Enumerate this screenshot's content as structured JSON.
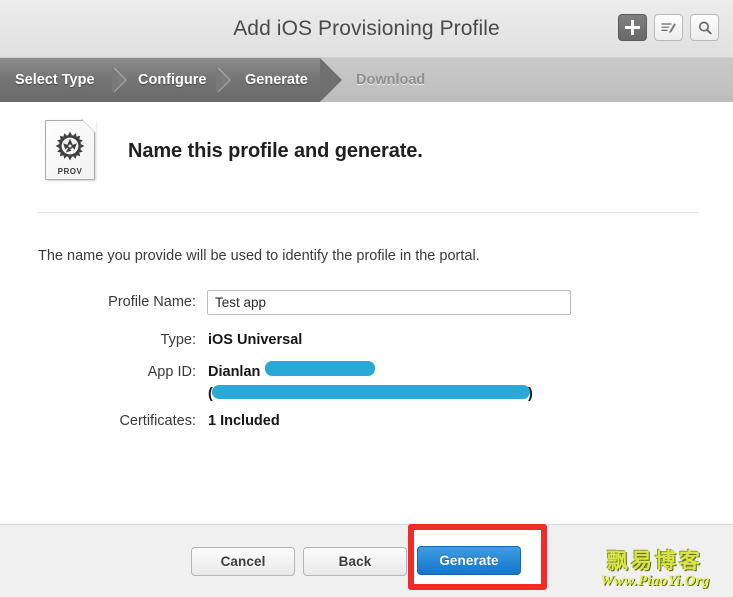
{
  "window": {
    "title": "Add iOS Provisioning Profile"
  },
  "toolbar": {
    "add_icon": "plus-icon",
    "edit_icon": "edit-pencil-icon",
    "search_icon": "search-icon"
  },
  "steps": [
    {
      "label": "Select Type",
      "state": "done"
    },
    {
      "label": "Configure",
      "state": "done"
    },
    {
      "label": "Generate",
      "state": "current"
    },
    {
      "label": "Download",
      "state": "upcoming"
    }
  ],
  "header": {
    "icon_label": "PROV",
    "icon_name": "provisioning-profile-document-icon",
    "title": "Name this profile and generate."
  },
  "main": {
    "lead_text": "The name you provide will be used to identify the profile in the portal.",
    "fields": [
      {
        "label": "Profile Name:",
        "type": "input",
        "value": "Test app",
        "placeholder": ""
      },
      {
        "label": "Type:",
        "type": "text",
        "value": "iOS Universal"
      },
      {
        "label": "App ID:",
        "type": "redacted",
        "value": "Dianlan",
        "line2_prefix": "(",
        "line2_suffix": ")"
      },
      {
        "label": "Certificates:",
        "type": "text",
        "value": "1 Included"
      }
    ]
  },
  "footer": {
    "cancel_label": "Cancel",
    "back_label": "Back",
    "generate_label": "Generate"
  },
  "colors": {
    "redaction_blue": "#2aa9d6",
    "primary_button_blue": "#1575ca",
    "highlight_red": "#f22a2a",
    "watermark_yellow": "#d9e64a"
  },
  "watermark": {
    "line1": "飘易博客",
    "line2": "Www.PiaoYi.Org"
  }
}
